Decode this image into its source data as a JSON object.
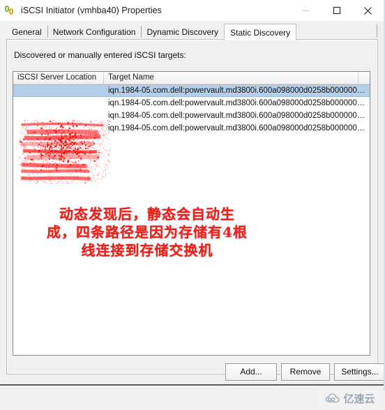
{
  "window": {
    "title": "iSCSI Initiator (vmhba40) Properties",
    "icon": "iscsi-link-icon",
    "controls": {
      "minimize": "minimize-icon",
      "maximize": "maximize-icon",
      "close": "close-icon"
    }
  },
  "tabs": [
    {
      "label": "General",
      "active": false
    },
    {
      "label": "Network Configuration",
      "active": false
    },
    {
      "label": "Dynamic Discovery",
      "active": false
    },
    {
      "label": "Static Discovery",
      "active": true
    }
  ],
  "page": {
    "targets_label": "Discovered or manually entered iSCSI targets:",
    "columns": [
      {
        "label": "iSCSI Server Location"
      },
      {
        "label": "Target Name"
      },
      {
        "label": ""
      }
    ],
    "rows": [
      {
        "server_location": "",
        "target_name": "iqn.1984-05.com.dell:powervault.md3800i.600a098000d0258b000000…",
        "selected": true
      },
      {
        "server_location": "",
        "target_name": "iqn.1984-05.com.dell:powervault.md3800i.600a098000d0258b000000…",
        "selected": false
      },
      {
        "server_location": "",
        "target_name": "iqn.1984-05.com.dell:powervault.md3800i.600a098000d0258b000000…",
        "selected": false
      },
      {
        "server_location": "",
        "target_name": "iqn.1984-05.com.dell:powervault.md3800i.600a098000d0258b000000…",
        "selected": false
      }
    ],
    "annotation": "动态发现后，静态会自动生成，四条路径是因为存储有4根线连接到存储交换机",
    "annotation_color": "#e8221c",
    "redaction_color": "#ff0000"
  },
  "buttons": {
    "add": "Add...",
    "remove": "Remove",
    "settings": "Settings..."
  },
  "watermark": {
    "text": "亿速云",
    "icon": "cloud-icon"
  },
  "colors": {
    "selection": "#b4cfe7",
    "dialog_bg": "#f0f0f0",
    "list_bg": "#ffffff"
  }
}
